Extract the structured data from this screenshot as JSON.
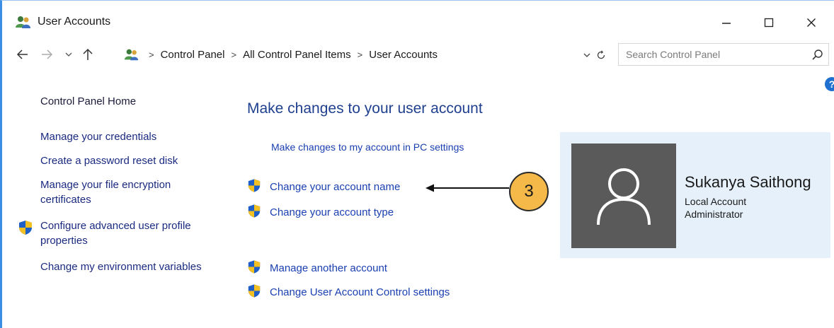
{
  "window": {
    "title": "User Accounts"
  },
  "address": {
    "breadcrumbs": [
      "Control Panel",
      "All Control Panel Items",
      "User Accounts"
    ]
  },
  "search": {
    "placeholder": "Search Control Panel"
  },
  "left_pane": {
    "home": "Control Panel Home",
    "links": {
      "credentials": "Manage your credentials",
      "reset_disk": "Create a password reset disk",
      "encryption": "Manage your file encryption certificates",
      "profile": "Configure advanced user profile properties",
      "environment": "Change my environment variables"
    }
  },
  "main": {
    "title": "Make changes to your user account",
    "pc_settings_link": "Make changes to my account in PC settings",
    "tasks": {
      "change_name": "Change your account name",
      "change_type": "Change your account type",
      "manage_other": "Manage another account",
      "uac_settings": "Change User Account Control settings"
    }
  },
  "annotation": {
    "step_number": "3",
    "color": "#f5b94a"
  },
  "account": {
    "name": "Sukanya Saithong",
    "type": "Local Account",
    "role": "Administrator"
  },
  "icons": {
    "app": "users-icon",
    "shield": "uac-shield-icon",
    "avatar": "user-silhouette-icon",
    "help": "help-icon"
  },
  "colors": {
    "link": "#1a3fb0",
    "title": "#1f3f8f",
    "card_bg": "#e5f0fa",
    "avatar_bg": "#5a5a5a"
  }
}
